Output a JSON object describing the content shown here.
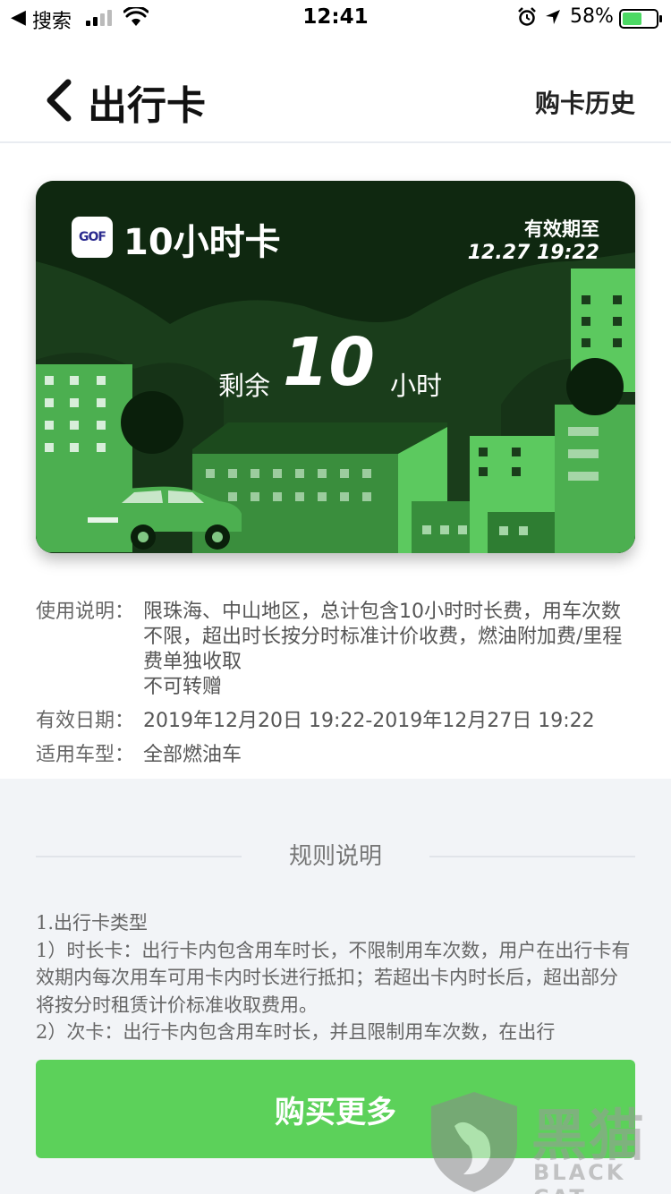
{
  "status_bar": {
    "back_glyph": "◀",
    "carrier": "搜索",
    "time": "12:41",
    "battery_percent": "58%",
    "battery_level": 0.58
  },
  "nav": {
    "title": "出行卡",
    "history_label": "购卡历史"
  },
  "card": {
    "logo_text": "GOF",
    "title": "10小时卡",
    "valid_label": "有效期至",
    "valid_date": "12.27 19:22",
    "remain_label": "剩余",
    "remain_value": "10",
    "remain_unit": "小时"
  },
  "info": {
    "usage_label": "使用说明：",
    "usage_lines": [
      "限珠海、中山地区，总计包含10小时时长费，用车次数不限，超出时长按分时标准计价收费，燃油附加费/里程费单独收取",
      "不可转赠"
    ],
    "validity_label": "有效日期：",
    "validity_value": "2019年12月20日 19:22-2019年12月27日 19:22",
    "vehicle_label": "适用车型：",
    "vehicle_value": "全部燃油车"
  },
  "rules": {
    "heading": "规则说明",
    "lines": [
      "1.出行卡类型",
      "1）时长卡：出行卡内包含用车时长，不限制用车次数，用户在出行卡有效期内每次用车可用卡内时长进行抵扣；若超出卡内时长后，超出部分将按分时租赁计价标准收取费用。",
      "2）次卡：出行卡内包含用车时长，并且限制用车次数，在出行"
    ]
  },
  "buy_button": {
    "label": "购买更多"
  },
  "watermark": {
    "cn": "黑猫",
    "en": "BLACK CAT"
  },
  "colors": {
    "accent_green": "#5cd15a",
    "card_dark": "#0f2810",
    "building_green": "#4caf50"
  }
}
